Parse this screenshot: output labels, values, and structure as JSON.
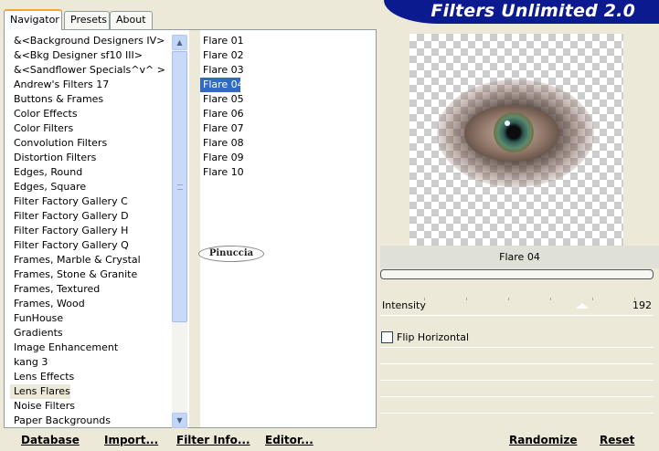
{
  "tabs": [
    {
      "label": "Navigator",
      "active": true
    },
    {
      "label": "Presets",
      "active": false
    },
    {
      "label": "About",
      "active": false
    }
  ],
  "banner": {
    "title": "Filters Unlimited 2.0"
  },
  "categories": [
    "&<Background Designers IV>",
    "&<Bkg Designer sf10 III>",
    "&<Sandflower Specials^v^ >",
    "Andrew's Filters 17",
    "Buttons & Frames",
    "Color Effects",
    "Color Filters",
    "Convolution Filters",
    "Distortion Filters",
    "Edges, Round",
    "Edges, Square",
    "Filter Factory Gallery C",
    "Filter Factory Gallery D",
    "Filter Factory Gallery H",
    "Filter Factory Gallery Q",
    "Frames, Marble & Crystal",
    "Frames, Stone & Granite",
    "Frames, Textured",
    "Frames, Wood",
    "FunHouse",
    "Gradients",
    "Image Enhancement",
    "kang 3",
    "Lens Effects",
    "Lens Flares",
    "Noise Filters",
    "Paper Backgrounds"
  ],
  "selected_category": "Lens Flares",
  "filters": [
    "Flare 01",
    "Flare 02",
    "Flare 03",
    "Flare 04",
    "Flare 05",
    "Flare 06",
    "Flare 07",
    "Flare 08",
    "Flare 09",
    "Flare 10"
  ],
  "selected_filter": "Flare 04",
  "watermark": "Pinuccia",
  "buttons": {
    "database": "Database",
    "import": "Import...",
    "filter_info": "Filter Info...",
    "editor": "Editor...",
    "randomize": "Randomize",
    "reset": "Reset"
  },
  "preview": {
    "filter_name": "Flare 04",
    "progress": 0
  },
  "controls": {
    "intensity_label": "Intensity",
    "intensity_value": "192",
    "intensity_max": 255,
    "flip_label": "Flip Horizontal",
    "flip_checked": false
  },
  "colors": {
    "banner": "#0b1b8f",
    "selection": "#316ac5",
    "background": "#ece9d8"
  }
}
